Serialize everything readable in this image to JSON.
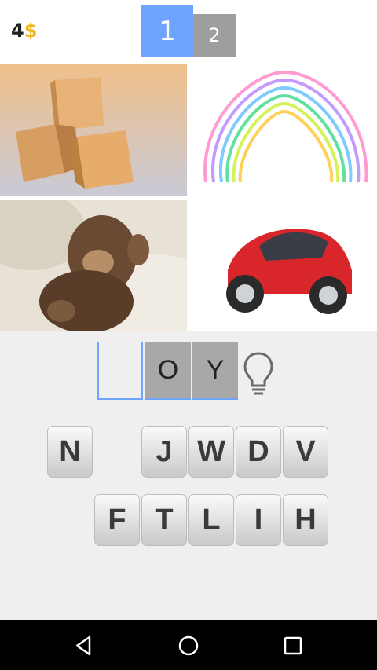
{
  "header": {
    "coins": "4",
    "currency": "$",
    "level_current": "1",
    "level_next": "2"
  },
  "images": [
    {
      "icon": "wooden-blocks-image"
    },
    {
      "icon": "slinky-image"
    },
    {
      "icon": "teddy-monkey-image"
    },
    {
      "icon": "toy-car-image"
    }
  ],
  "answer": {
    "slots": [
      "",
      "O",
      "Y"
    ],
    "hint_icon": "lightbulb-icon"
  },
  "keyboard": {
    "row1": [
      "N",
      "J",
      "W",
      "D",
      "V"
    ],
    "row2": [
      "F",
      "T",
      "L",
      "I",
      "H"
    ]
  },
  "nav": {
    "back_icon": "back-triangle-icon",
    "home_icon": "home-circle-icon",
    "recents_icon": "recents-square-icon"
  },
  "colors": {
    "accent": "#6ea3ff",
    "coin": "#f2b51c",
    "level_inactive": "#9e9e9e"
  }
}
